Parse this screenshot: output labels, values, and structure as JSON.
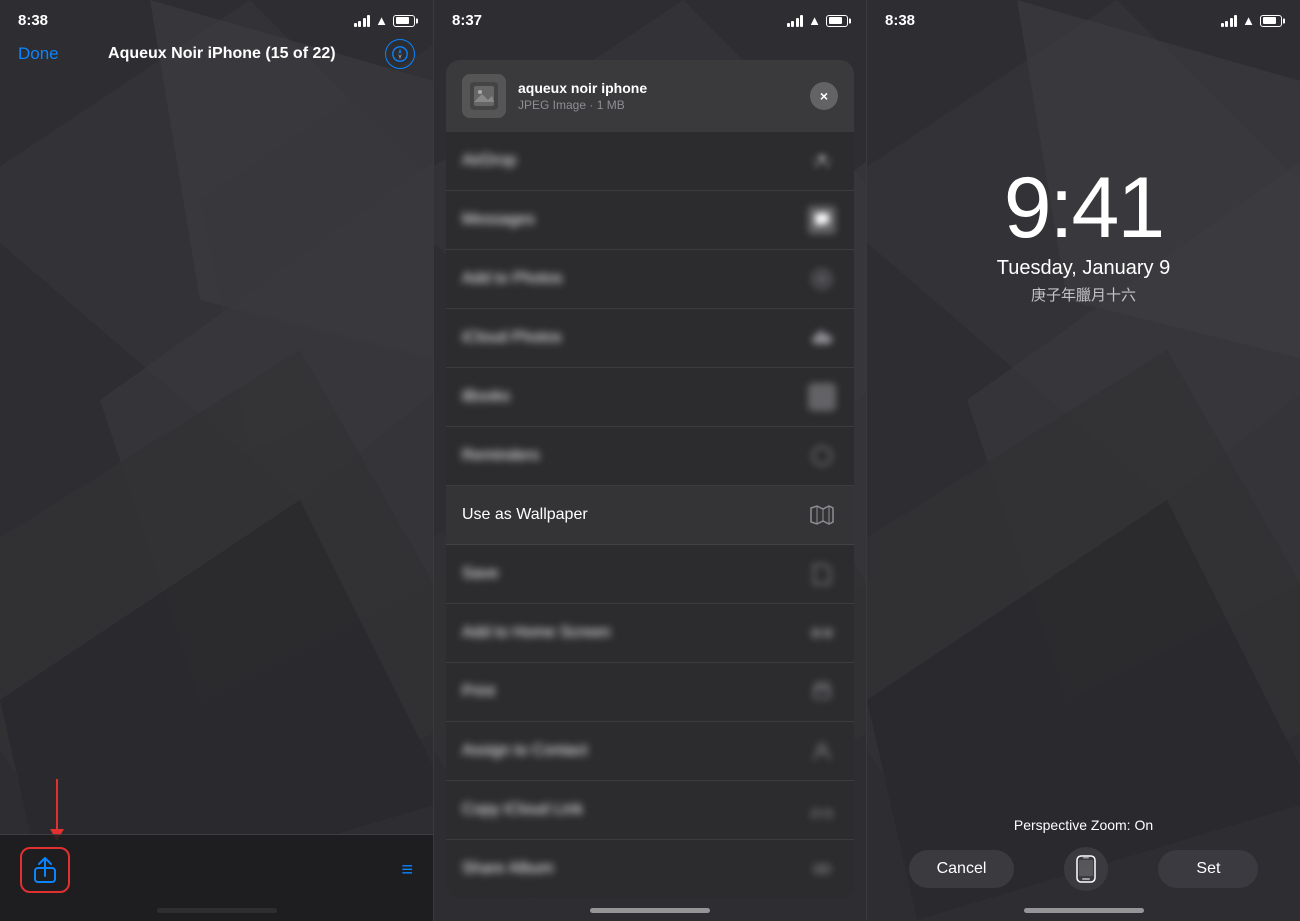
{
  "panel1": {
    "status_time": "8:38",
    "nav_done": "Done",
    "nav_title": "Aqueux Noir iPhone (15 of 22)",
    "toolbar_list_icon": "≡"
  },
  "panel2": {
    "status_time": "8:37",
    "share_sheet": {
      "title": "aqueux noir iphone",
      "meta": "JPEG Image · 1 MB",
      "close_label": "×",
      "items": [
        {
          "label": "AirDrop",
          "blurred": true,
          "icon": "share"
        },
        {
          "label": "Messages",
          "blurred": true,
          "icon": "messages"
        },
        {
          "label": "Add to Photos",
          "blurred": true,
          "icon": "photos"
        },
        {
          "label": "iCloud Photos",
          "blurred": true,
          "icon": "icloud"
        },
        {
          "label": "iBooks",
          "blurred": true,
          "icon": "books"
        },
        {
          "label": "Reminders",
          "blurred": true,
          "icon": "reminders"
        },
        {
          "label": "Use as Wallpaper",
          "blurred": false,
          "icon": "map"
        },
        {
          "label": "Save",
          "blurred": true,
          "icon": "save"
        },
        {
          "label": "Add to Home Screen",
          "blurred": true,
          "icon": "homescreen"
        },
        {
          "label": "Print",
          "blurred": true,
          "icon": "print"
        },
        {
          "label": "Assign to Contact",
          "blurred": true,
          "icon": "contact"
        },
        {
          "label": "Copy iCloud Link",
          "blurred": true,
          "icon": "link"
        },
        {
          "label": "Share Album",
          "blurred": true,
          "icon": "album"
        }
      ]
    }
  },
  "panel3": {
    "status_time": "8:38",
    "lock_time": "9:41",
    "lock_date": "Tuesday, January 9",
    "lock_lunar": "庚子年臘月十六",
    "perspective_label": "Perspective Zoom: On",
    "btn_cancel": "Cancel",
    "btn_set": "Set"
  }
}
